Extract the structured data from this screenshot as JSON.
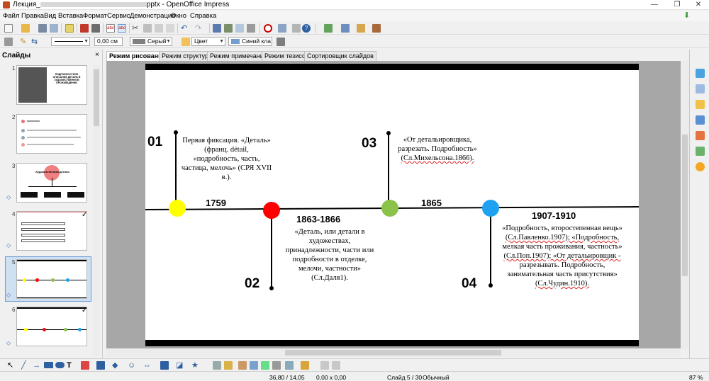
{
  "window": {
    "title_prefix": "Лекция_",
    "title_suffix": "pptx - OpenOffice Impress",
    "minimize": "—",
    "maximize": "❐",
    "close": "✕"
  },
  "menu": [
    "Файл",
    "Правка",
    "Вид",
    "Вставка",
    "Формат",
    "Сервис",
    "Демонстрация",
    "Окно",
    "Справка"
  ],
  "format_bar": {
    "line_width": "0,00 см",
    "line_color": "Серый",
    "area_style": "Цвет",
    "area_color": "Синий кла"
  },
  "slides_pane": {
    "title": "Слайды",
    "close": "×",
    "slides": [
      {
        "num": "1"
      },
      {
        "num": "2"
      },
      {
        "num": "3"
      },
      {
        "num": "4"
      },
      {
        "num": "5"
      },
      {
        "num": "6"
      }
    ],
    "thumb1_text": "ПОДРОБНОСТНОЕ ОПИСАНИЕ ДЕТАЛЬ В ХУДОЖЕСТВЕННОМ ПРОИЗВЕДЕНИИ",
    "thumb3_text": "Художественная деталь"
  },
  "tabs": [
    "Режим рисования",
    "Режим структуры",
    "Режим примечаний",
    "Режим тезисов",
    "Сортировщик слайдов"
  ],
  "slide": {
    "numbers": [
      "01",
      "02",
      "03",
      "04"
    ],
    "years": [
      "1759",
      "1863-1866",
      "1865",
      "1907-1910"
    ],
    "text01": [
      "Первая фиксация. «Деталь»",
      "(франц. détail,",
      "«подробность, часть,",
      "частица, мелочь» (СРЯ XVII",
      "в.)."
    ],
    "text02": [
      "«Деталь, или детали в",
      "художествах,",
      "принадлежности, части или",
      "подробности в отделке,",
      "мелочи, частности»",
      "(Сл.Даля1)."
    ],
    "text03": [
      "«От детальировщика,",
      "разрезать. Подробность»"
    ],
    "text03_ref": "(Сл.Михельсона.1866).",
    "text04": [
      "«Подробность, второстепенная вещь»"
    ],
    "text04_ref1": "(Сл.Павленко.1907); «Подробность,",
    "text04_mid": [
      "мелкая часть проживания, частность»"
    ],
    "text04_ref2": "(Сл.Поп.1907); «От детальировщик -",
    "text04_tail": [
      "разрезывать. Подробность,",
      "занимательная часть присутствия»"
    ],
    "text04_ref3": "(Сл.Чудин.1910).",
    "dot_colors": [
      "#ffff00",
      "#ff0000",
      "#8bc34a",
      "#1ea1f1"
    ]
  },
  "status": {
    "position": "36,80 / 14,05",
    "size": "0,00 x 0,00",
    "slide": "Слайд 5 / 30",
    "layout": "Обычный",
    "zoom": "87 %"
  }
}
